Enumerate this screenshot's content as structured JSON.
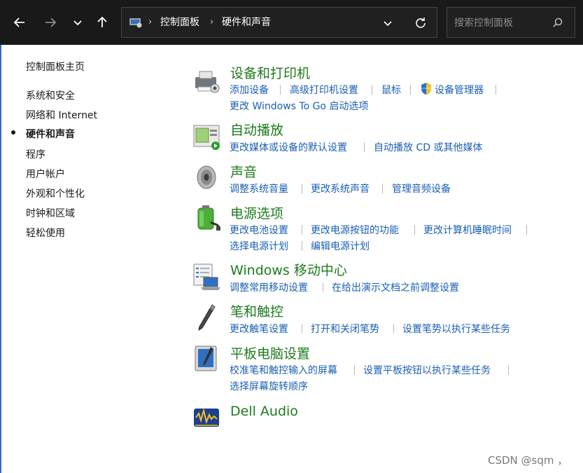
{
  "address_bar": {
    "breadcrumbs": [
      "控制面板",
      "硬件和声音"
    ],
    "search_placeholder": "搜索控制面板"
  },
  "sidebar": {
    "home": "控制面板主页",
    "items": [
      {
        "label": "系统和安全",
        "active": false
      },
      {
        "label": "网络和 Internet",
        "active": false
      },
      {
        "label": "硬件和声音",
        "active": true
      },
      {
        "label": "程序",
        "active": false
      },
      {
        "label": "用户帐户",
        "active": false
      },
      {
        "label": "外观和个性化",
        "active": false
      },
      {
        "label": "时钟和区域",
        "active": false
      },
      {
        "label": "轻松使用",
        "active": false
      }
    ]
  },
  "categories": [
    {
      "title": "设备和打印机",
      "icon": "printer-icon",
      "links": [
        "添加设备",
        "高级打印机设置",
        "鼠标",
        "设备管理器",
        "更改 Windows To Go 启动选项"
      ]
    },
    {
      "title": "自动播放",
      "icon": "autoplay-icon",
      "links": [
        "更改媒体或设备的默认设置",
        "自动播放 CD 或其他媒体"
      ]
    },
    {
      "title": "声音",
      "icon": "speaker-icon",
      "links": [
        "调整系统音量",
        "更改系统声音",
        "管理音频设备"
      ]
    },
    {
      "title": "电源选项",
      "icon": "battery-icon",
      "links": [
        "更改电池设置",
        "更改电源按钮的功能",
        "更改计算机睡眠时间",
        "选择电源计划",
        "编辑电源计划"
      ]
    },
    {
      "title": "Windows 移动中心",
      "icon": "mobility-center-icon",
      "links": [
        "调整常用移动设置",
        "在给出演示文档之前调整设置"
      ]
    },
    {
      "title": "笔和触控",
      "icon": "pen-icon",
      "links": [
        "更改触笔设置",
        "打开和关闭笔势",
        "设置笔势以执行某些任务"
      ]
    },
    {
      "title": "平板电脑设置",
      "icon": "tablet-icon",
      "links": [
        "校准笔和触控输入的屏幕",
        "设置平板按钮以执行某些任务",
        "选择屏幕旋转顺序"
      ]
    },
    {
      "title": "Dell Audio",
      "icon": "dell-audio-icon",
      "links": []
    }
  ],
  "watermark": "CSDN @sqm ，",
  "colors": {
    "title_green": "#1e7b1e",
    "link_blue": "#1a5fb4",
    "topbar": "#191919"
  }
}
